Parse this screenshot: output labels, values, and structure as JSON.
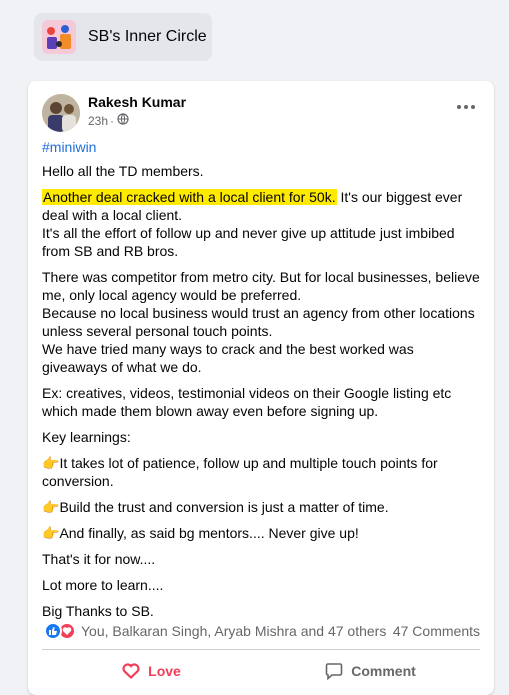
{
  "group": {
    "name": "SB's Inner Circle"
  },
  "post": {
    "author": "Rakesh Kumar",
    "time": "23h",
    "separator": "·",
    "hashtag": "#miniwin",
    "greeting": "Hello all the TD members.",
    "highlight": "Another deal cracked with a local client for 50k.",
    "p1_rest": " It's our biggest ever deal with a local client.",
    "p1_line2": "It's all the effort of follow up and never give up attitude just imbibed from SB and RB bros.",
    "p2_a": "There was competitor from metro city. But for local businesses, believe me, only local agency would be preferred.",
    "p2_b": "Because no local business would trust an agency from other locations unless several personal touch points.",
    "p2_c": "We have tried many ways to crack and the best worked was giveaways of what we do.",
    "p3": "Ex: creatives, videos, testimonial videos on their Google listing etc which made them blown away even before signing up.",
    "key_heading": "Key learnings:",
    "point_emoji": "👉",
    "point1": "It takes lot of patience, follow up and multiple touch points for conversion.",
    "point2": "Build the trust and conversion is just a matter of time.",
    "point3": "And finally, as said bg mentors.... Never give up!",
    "close1": "That's it for now....",
    "close2": "Lot more to learn....",
    "close3": "Big Thanks to SB."
  },
  "reactions": {
    "summary": "You, Balkaran Singh, Aryab Mishra and 47 others",
    "comments": "47 Comments"
  },
  "actions": {
    "love": "Love",
    "comment": "Comment"
  },
  "colors": {
    "accent": "#216fdb",
    "love": "#f33e58",
    "like": "#1877f2",
    "highlight": "#ffea00"
  },
  "icons": [
    "group-avatar-icon",
    "globe-icon",
    "more-options-icon",
    "like-reaction-icon",
    "love-reaction-icon",
    "heart-icon",
    "comment-icon",
    "point-right-emoji"
  ]
}
